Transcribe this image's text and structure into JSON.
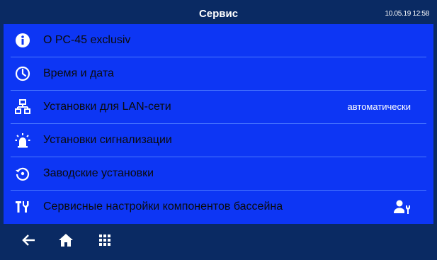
{
  "header": {
    "title": "Сервис",
    "datetime": "10.05.19  12:58"
  },
  "menu": {
    "items": [
      {
        "label": "О РС-45 exclusiv",
        "icon": "info-icon"
      },
      {
        "label": "Время и дата",
        "icon": "clock-icon"
      },
      {
        "label": "Установки для LAN-сети",
        "icon": "network-icon",
        "value": "автоматически"
      },
      {
        "label": "Установки сигнализации",
        "icon": "alarm-beacon-icon"
      },
      {
        "label": "Заводские установки",
        "icon": "reset-icon"
      },
      {
        "label": "Сервисные настройки компонентов бассейна",
        "icon": "tools-icon",
        "right_icon": "user-service-icon"
      }
    ]
  },
  "footer": {
    "buttons": [
      "back-arrow-icon",
      "home-icon",
      "grid-menu-icon"
    ]
  },
  "colors": {
    "frame": "#0a2a63",
    "list_background": "#0d36f4",
    "divider": "#4a78ff",
    "text_dark": "#0b0b0b",
    "text_light": "#ffffff"
  }
}
